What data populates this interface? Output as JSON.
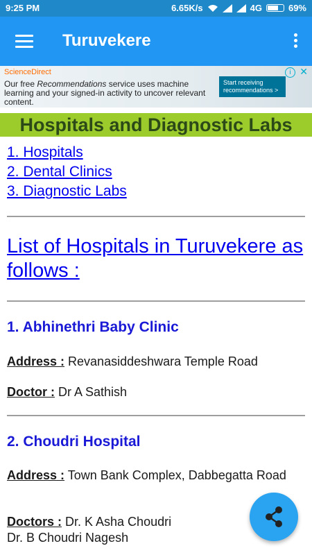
{
  "status_bar": {
    "time": "9:25 PM",
    "network_speed": "6.65K/s",
    "network_type": "4G",
    "battery": "69%",
    "battery_level": 0.69
  },
  "app_bar": {
    "title": "Turuvekere",
    "menu_icon": "hamburger-menu-icon",
    "overflow_icon": "more-vert-icon"
  },
  "ad": {
    "brand": "ScienceDirect",
    "line_prefix": "Our free ",
    "line_em": "Recommendations",
    "line_rest": " service uses machine learning and your signed-in activity to uncover relevant content.",
    "cta": "Start receiving recommendations >",
    "info_glyph": "i",
    "close_glyph": "✕"
  },
  "section_title": "Hospitals and Diagnostic Labs",
  "links": [
    "1. Hospitals",
    "2. Dental Clinics",
    "3. Diagnostic Labs"
  ],
  "list_title": "List of Hospitals in Turuvekere as follows :",
  "hospitals": [
    {
      "name": "1. Abhinethri Baby Clinic",
      "address_label": "Address :",
      "address": " Revanasiddeshwara Temple Road",
      "doctor_label": "Doctor :",
      "doctor": " Dr A Sathish"
    },
    {
      "name": "2. Choudri Hospital",
      "address_label": "Address :",
      "address": " Town Bank Complex, Dabbegatta Road",
      "doctor_label": "Doctors :",
      "doctor": " Dr. K Asha Choudri",
      "doctor2": "Dr. B Choudri Nagesh"
    }
  ],
  "fab": {
    "icon": "share-icon"
  },
  "colors": {
    "status_bar": "#1e88c9",
    "app_bar": "#2196f3",
    "banner": "#9ccc2c",
    "link": "#0000ee",
    "fab": "#2aa3f0"
  }
}
